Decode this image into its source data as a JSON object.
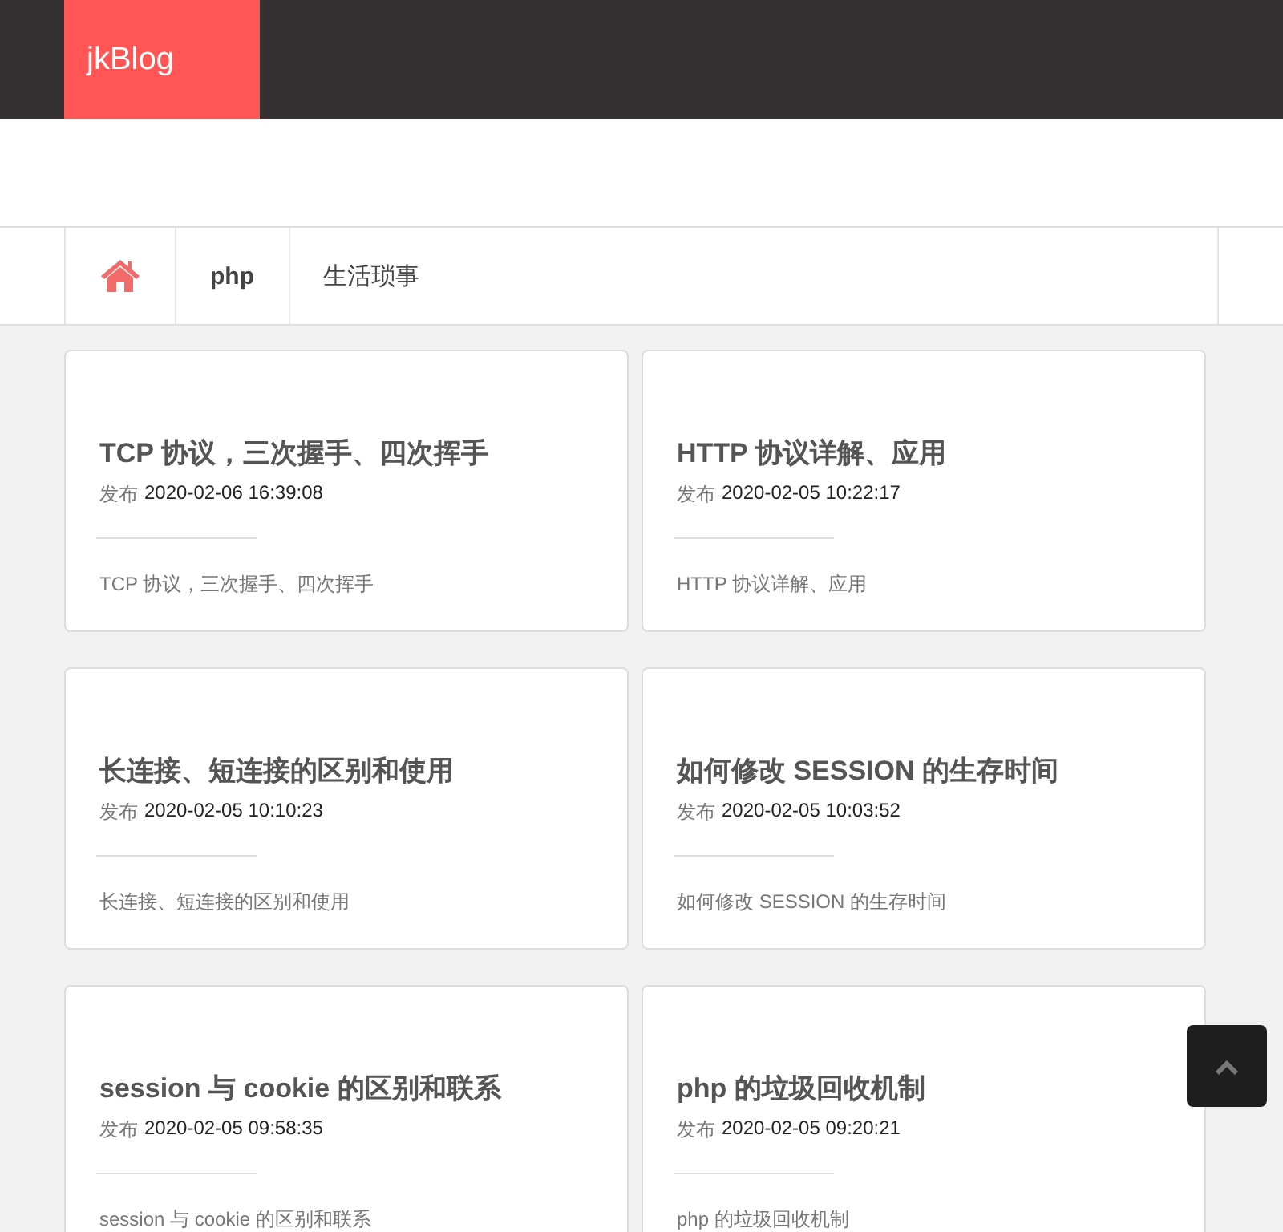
{
  "header": {
    "logo": "jkBlog"
  },
  "nav": [
    {
      "kind": "home"
    },
    {
      "kind": "text",
      "label": "php",
      "bold": true
    },
    {
      "kind": "text",
      "label": "生活琐事",
      "bold": false
    }
  ],
  "posts": [
    {
      "title": "TCP 协议，三次握手、四次挥手",
      "published_label": "发布",
      "date": "2020-02-06 16:39:08",
      "excerpt": "TCP 协议，三次握手、四次挥手"
    },
    {
      "title": "HTTP 协议详解、应用",
      "published_label": "发布",
      "date": "2020-02-05 10:22:17",
      "excerpt": "HTTP 协议详解、应用"
    },
    {
      "title": "长连接、短连接的区别和使用",
      "published_label": "发布",
      "date": "2020-02-05 10:10:23",
      "excerpt": "长连接、短连接的区别和使用"
    },
    {
      "title": "如何修改 SESSION 的生存时间",
      "published_label": "发布",
      "date": "2020-02-05 10:03:52",
      "excerpt": "如何修改 SESSION 的生存时间"
    },
    {
      "title": "session 与 cookie 的区别和联系",
      "published_label": "发布",
      "date": "2020-02-05 09:58:35",
      "excerpt": "session 与 cookie 的区别和联系"
    },
    {
      "title": "php 的垃圾回收机制",
      "published_label": "发布",
      "date": "2020-02-05 09:20:21",
      "excerpt": "php 的垃圾回收机制"
    }
  ]
}
